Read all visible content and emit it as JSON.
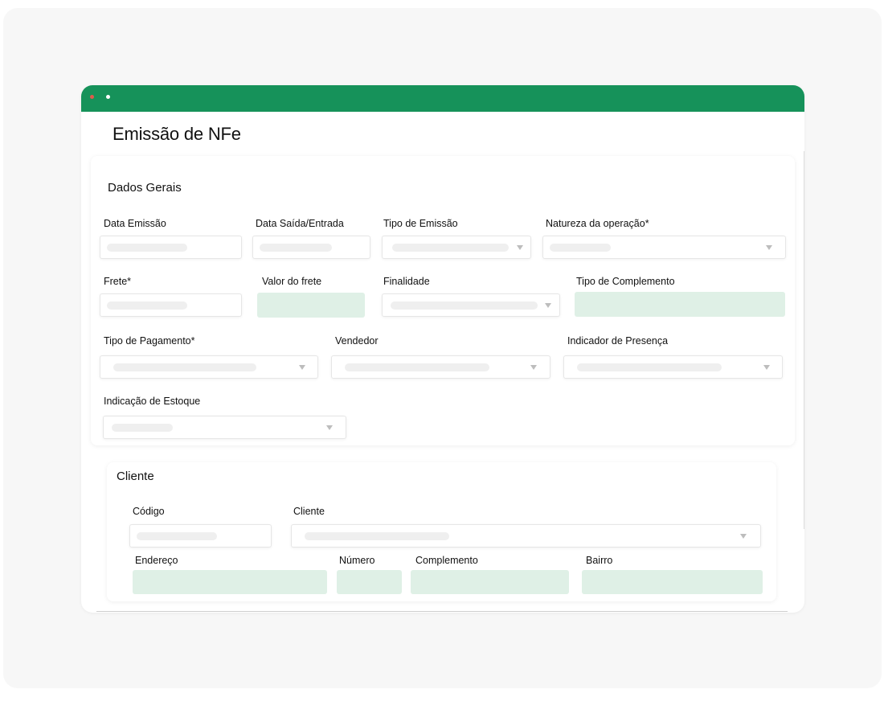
{
  "page_title": "Emissão de NFe",
  "colors": {
    "titlebar": "#16925a",
    "filled_field": "#dff0e6"
  },
  "dados_gerais": {
    "title": "Dados Gerais",
    "fields": {
      "data_emissao": "Data Emissão",
      "data_saida_entrada": "Data Saída/Entrada",
      "tipo_emissao": "Tipo de Emissão",
      "natureza_operacao": "Natureza da operação*",
      "frete": "Frete*",
      "valor_frete": "Valor do frete",
      "finalidade": "Finalidade",
      "tipo_complemento": "Tipo de Complemento",
      "tipo_pagamento": "Tipo de Pagamento*",
      "vendedor": "Vendedor",
      "indicador_presenca": "Indicador de Presença",
      "indicacao_estoque": "Indicação de Estoque"
    }
  },
  "cliente_section": {
    "title": "Cliente",
    "fields": {
      "codigo": "Código",
      "cliente": "Cliente",
      "endereco": "Endereço",
      "numero": "Número",
      "complemento": "Complemento",
      "bairro": "Bairro"
    }
  }
}
